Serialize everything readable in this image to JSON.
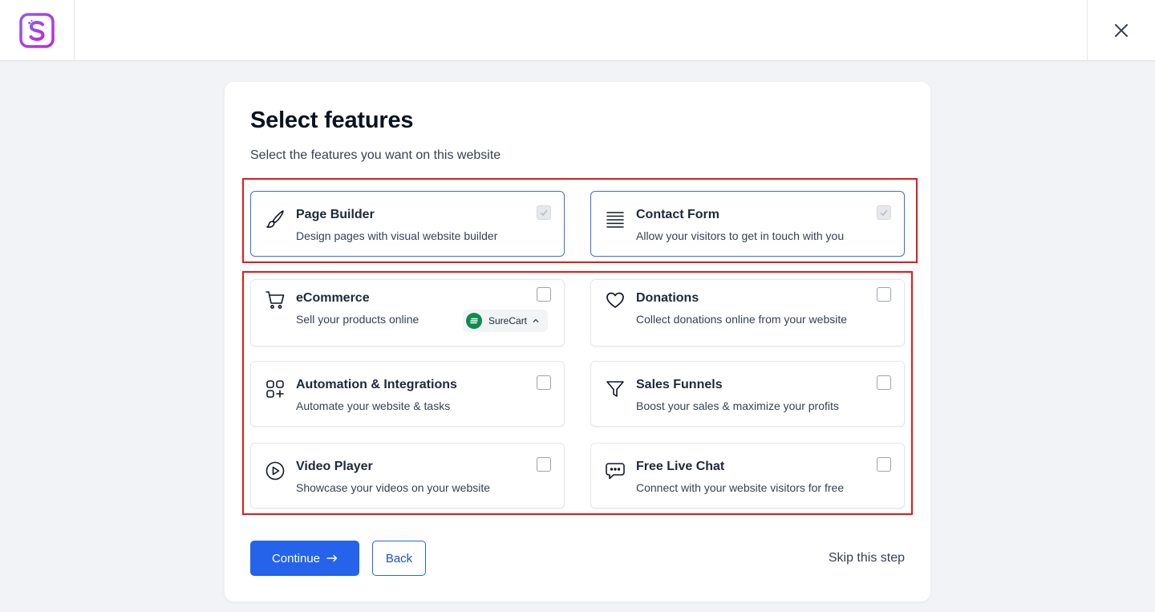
{
  "header": {
    "logo_icon": "starter-templates-s-logo",
    "close_icon": "close-icon"
  },
  "page": {
    "title": "Select features",
    "subtitle": "Select the features you want on this website"
  },
  "features": [
    {
      "id": "page-builder",
      "title": "Page Builder",
      "description": "Design pages with visual website builder",
      "icon": "paint-brush-icon",
      "checked": true
    },
    {
      "id": "contact-form",
      "title": "Contact Form",
      "description": "Allow your visitors to get in touch with you",
      "icon": "form-lines-icon",
      "checked": true
    },
    {
      "id": "ecommerce",
      "title": "eCommerce",
      "description": "Sell your products online",
      "icon": "shopping-cart-icon",
      "checked": false,
      "provider": "SureCart"
    },
    {
      "id": "donations",
      "title": "Donations",
      "description": "Collect donations online from your website",
      "icon": "heart-icon",
      "checked": false
    },
    {
      "id": "automation",
      "title": "Automation & Integrations",
      "description": "Automate your website & tasks",
      "icon": "grid-plus-icon",
      "checked": false
    },
    {
      "id": "sales-funnels",
      "title": "Sales Funnels",
      "description": "Boost your sales & maximize your profits",
      "icon": "funnel-icon",
      "checked": false
    },
    {
      "id": "video-player",
      "title": "Video Player",
      "description": "Showcase your videos on your website",
      "icon": "play-circle-icon",
      "checked": false
    },
    {
      "id": "live-chat",
      "title": "Free Live Chat",
      "description": "Connect with your website visitors for free",
      "icon": "chat-bubble-icon",
      "checked": false
    }
  ],
  "actions": {
    "continue_label": "Continue",
    "back_label": "Back",
    "skip_label": "Skip this step"
  },
  "colors": {
    "primary": "#2563eb",
    "highlight": "#e01b1b",
    "selected_border": "#3b6fd8",
    "surecart": "#0f8a4f"
  }
}
